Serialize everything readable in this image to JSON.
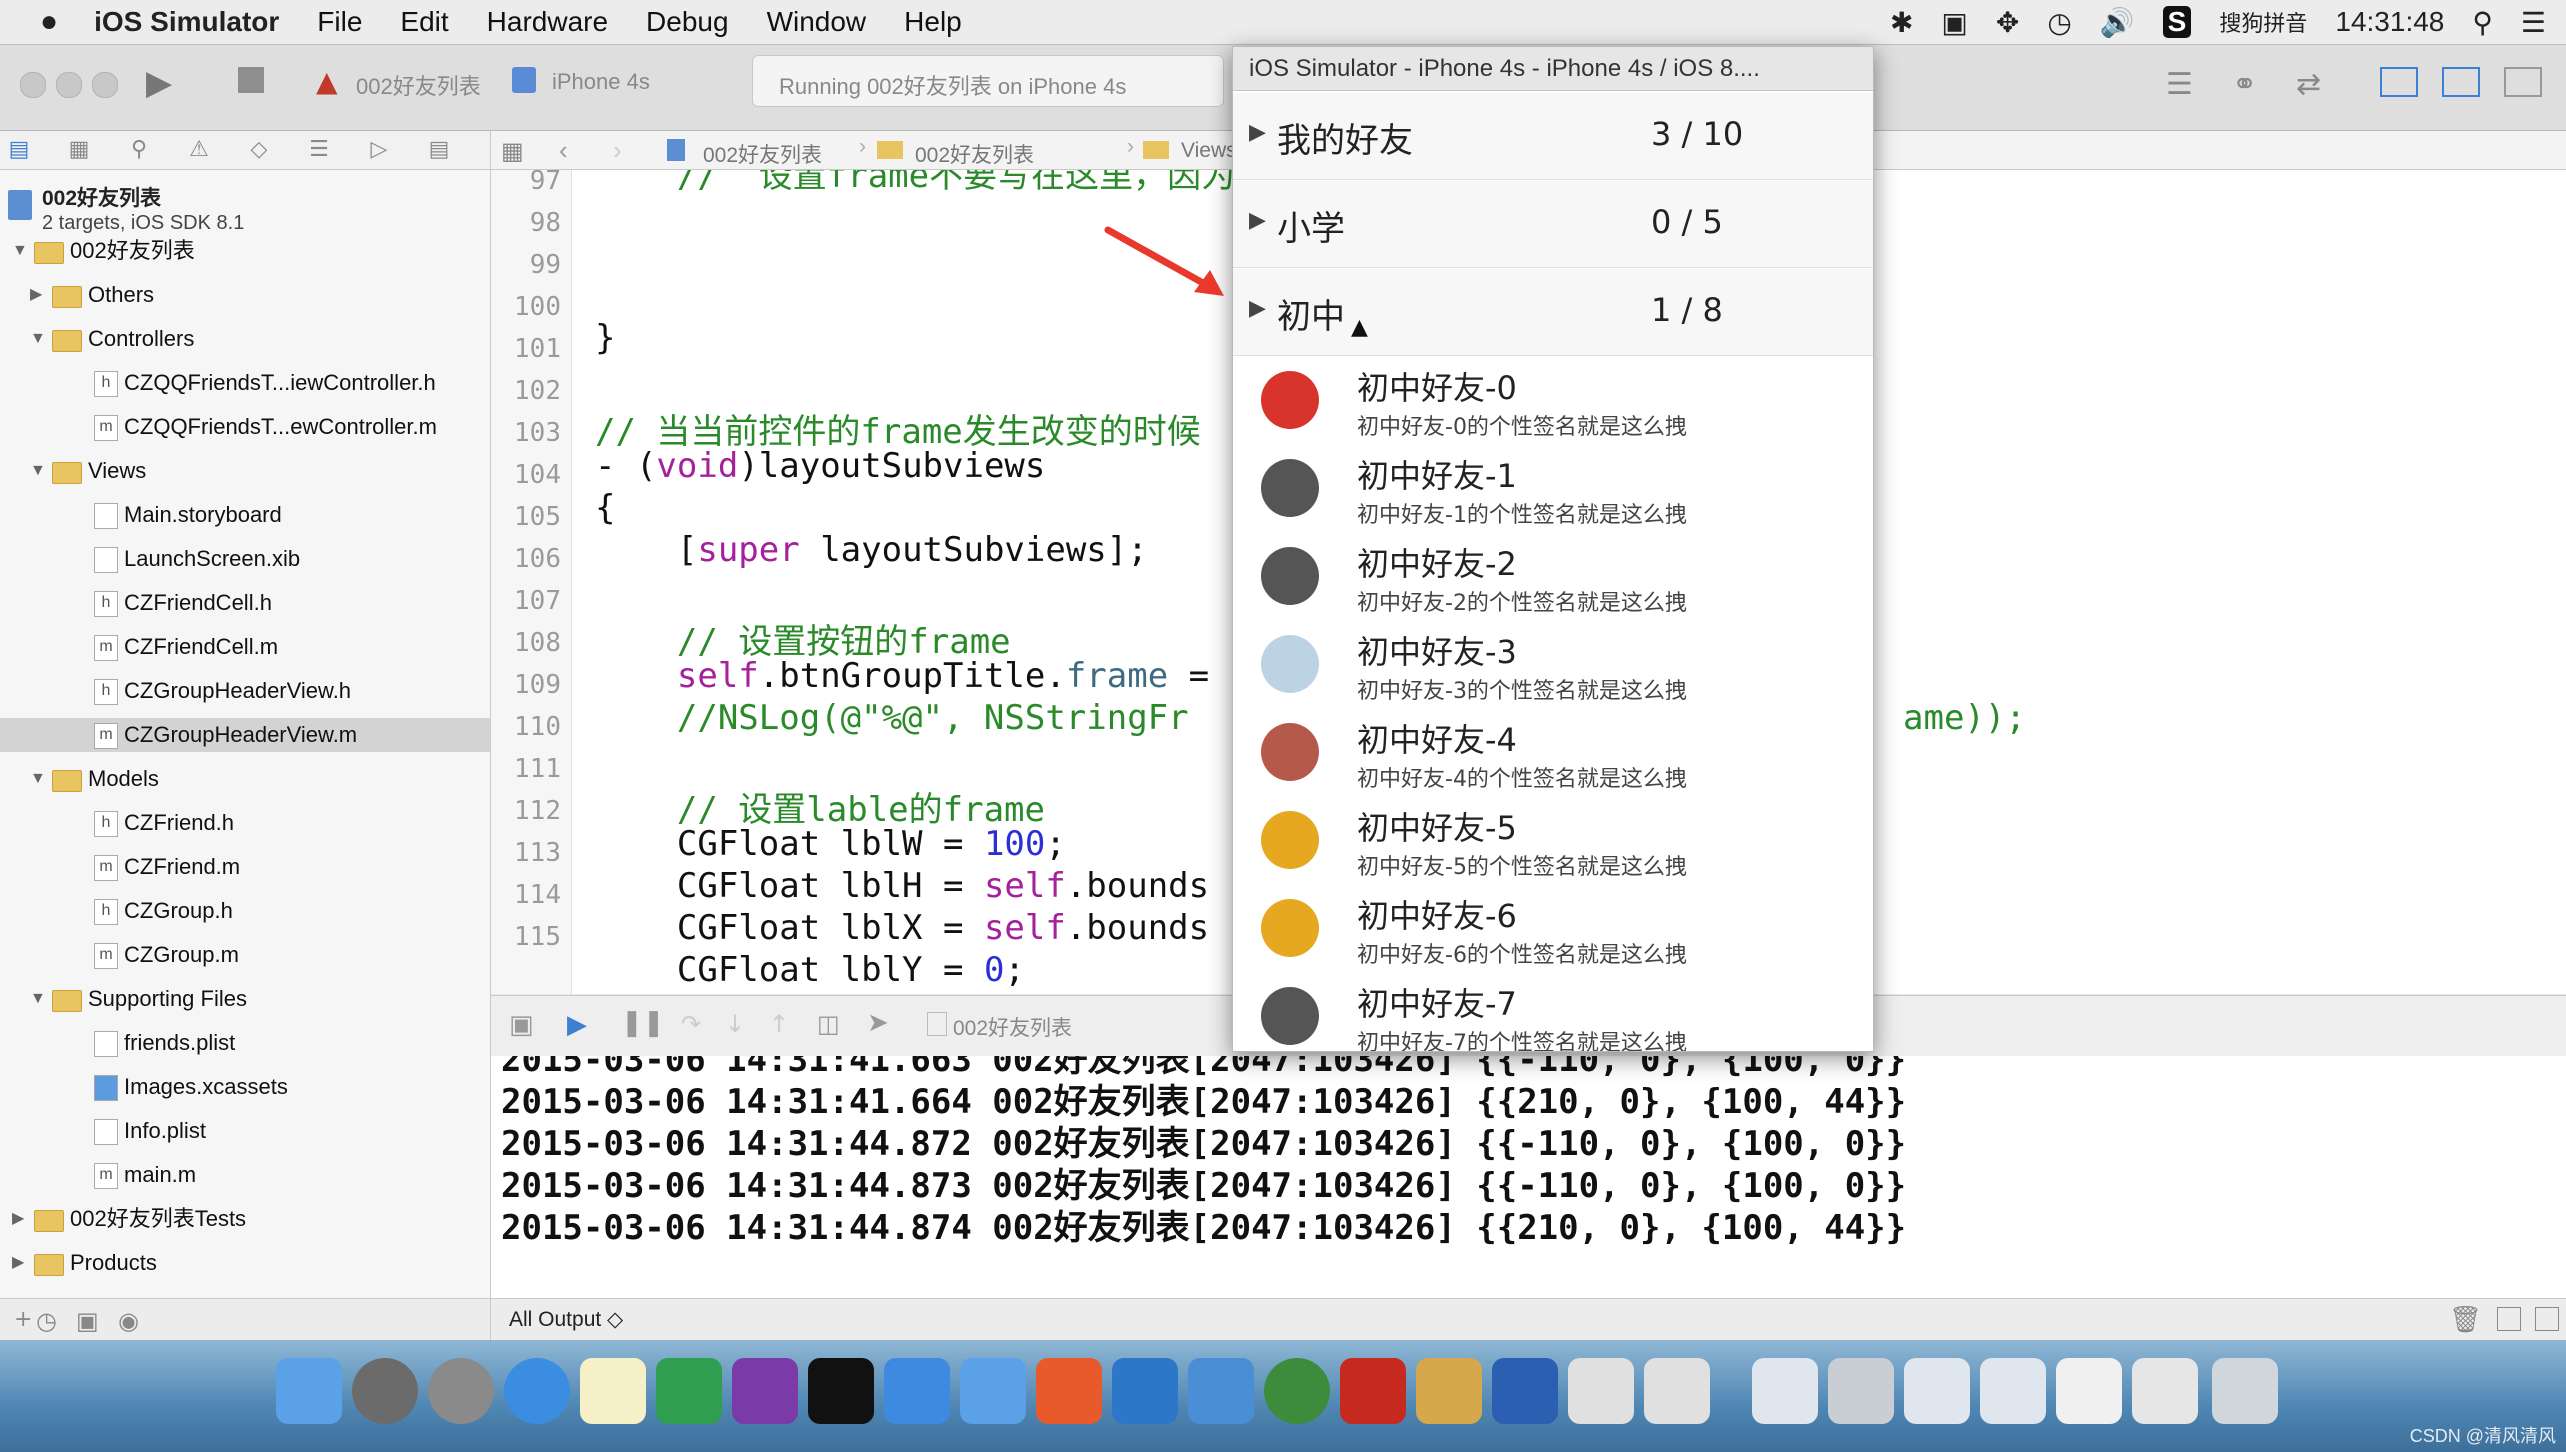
{
  "menubar": {
    "apple_icon": "apple-icon",
    "app_name": "iOS Simulator",
    "items": [
      "File",
      "Edit",
      "Hardware",
      "Debug",
      "Window",
      "Help"
    ],
    "input_method": "搜狗拼音",
    "time": "14:31:48"
  },
  "toolbar": {
    "scheme_target": "002好友列表",
    "scheme_device": "iPhone 4s",
    "status": "Running 002好友列表 on iPhone 4s"
  },
  "navigator": {
    "project_name": "002好友列表",
    "project_subtitle": "2 targets, iOS SDK 8.1",
    "items": [
      {
        "label": "002好友列表",
        "type": "folder",
        "expanded": true
      },
      {
        "label": "Others",
        "type": "folder",
        "expanded": false
      },
      {
        "label": "Controllers",
        "type": "folder",
        "expanded": true
      },
      {
        "label": "CZQQFriendsT...iewController.h",
        "type": "h"
      },
      {
        "label": "CZQQFriendsT...ewController.m",
        "type": "m"
      },
      {
        "label": "Views",
        "type": "folder",
        "expanded": true
      },
      {
        "label": "Main.storyboard",
        "type": "file"
      },
      {
        "label": "LaunchScreen.xib",
        "type": "file"
      },
      {
        "label": "CZFriendCell.h",
        "type": "h"
      },
      {
        "label": "CZFriendCell.m",
        "type": "m"
      },
      {
        "label": "CZGroupHeaderView.h",
        "type": "h"
      },
      {
        "label": "CZGroupHeaderView.m",
        "type": "m",
        "selected": true
      },
      {
        "label": "Models",
        "type": "folder",
        "expanded": true
      },
      {
        "label": "CZFriend.h",
        "type": "h"
      },
      {
        "label": "CZFriend.m",
        "type": "m"
      },
      {
        "label": "CZGroup.h",
        "type": "h"
      },
      {
        "label": "CZGroup.m",
        "type": "m"
      },
      {
        "label": "Supporting Files",
        "type": "folder",
        "expanded": true
      },
      {
        "label": "friends.plist",
        "type": "file"
      },
      {
        "label": "Images.xcassets",
        "type": "assets"
      },
      {
        "label": "Info.plist",
        "type": "file"
      },
      {
        "label": "main.m",
        "type": "m"
      },
      {
        "label": "002好友列表Tests",
        "type": "folder",
        "expanded": false
      },
      {
        "label": "Products",
        "type": "folder",
        "expanded": false
      }
    ]
  },
  "jumpbar": {
    "crumbs": [
      "002好友列表",
      "002好友列表",
      "Views",
      "m"
    ]
  },
  "editor": {
    "line_numbers": [
      "97",
      "98",
      "99",
      "100",
      "101",
      "102",
      "103",
      "104",
      "105",
      "106",
      "107",
      "108",
      "109",
      "110",
      "111",
      "112",
      "113",
      "114",
      "115"
    ],
    "lines": {
      "l100": "}",
      "l102": "// 当当前控件的frame发生改变的时候",
      "l103a": "- (",
      "l103b": "void",
      "l103c": ")layoutSubviews",
      "l104": "{",
      "l105a": "    [",
      "l105b": "super",
      "l105c": " layoutSubviews];",
      "l107": "    // 设置按钮的frame",
      "l108a": "    ",
      "l108b": "self",
      "l108c": ".btnGroupTitle.",
      "l108d": "frame",
      "l108e": " =",
      "l109a": "    //NSLog(@\"%@\", NSStringFr",
      "l109b": "ame));",
      "l111": "    // 设置lable的frame",
      "l112a": "    CGFloat lblW = ",
      "l112b": "100",
      "l112c": ";",
      "l113a": "    CGFloat lblH = ",
      "l113b": "self",
      "l113c": ".bounds",
      "l114a": "    CGFloat lblX = ",
      "l114b": "self",
      "l114c": ".bounds",
      "l115a": "    CGFloat lblY = ",
      "l115b": "0",
      "l115c": ";"
    }
  },
  "debugbar": {
    "target_label": "002好友列表"
  },
  "console": {
    "lines": [
      "2015-03-06 14:31:41.664 002好友列表[2047:103426] {{210, 0}, {100, 44}}",
      "2015-03-06 14:31:44.872 002好友列表[2047:103426] {{-110, 0}, {100, 0}}",
      "2015-03-06 14:31:44.873 002好友列表[2047:103426] {{-110, 0}, {100, 0}}",
      "2015-03-06 14:31:44.874 002好友列表[2047:103426] {{210, 0}, {100, 44}}"
    ],
    "output_filter": "All Output ◇"
  },
  "simulator": {
    "title": "iOS Simulator - iPhone 4s - iPhone 4s / iOS 8....",
    "groups": [
      {
        "name": "我的好友",
        "count": "3 / 10"
      },
      {
        "name": "小学",
        "count": "0 / 5"
      },
      {
        "name": "初中",
        "count": "1 / 8"
      }
    ],
    "friends": [
      {
        "name": "初中好友-0",
        "sig": "初中好友-0的个性签名就是这么拽",
        "avatar": "red-badge-avatar",
        "color": "#d8342b"
      },
      {
        "name": "初中好友-1",
        "sig": "初中好友-1的个性签名就是这么拽",
        "avatar": "panda-avatar",
        "color": "#555555"
      },
      {
        "name": "初中好友-2",
        "sig": "初中好友-2的个性签名就是这么拽",
        "avatar": "panda-avatar",
        "color": "#555555"
      },
      {
        "name": "初中好友-3",
        "sig": "初中好友-3的个性签名就是这么拽",
        "avatar": "cloud-avatar",
        "color": "#bcd3e3"
      },
      {
        "name": "初中好友-4",
        "sig": "初中好友-4的个性签名就是这么拽",
        "avatar": "people-avatar",
        "color": "#b55a4a"
      },
      {
        "name": "初中好友-5",
        "sig": "初中好友-5的个性签名就是这么拽",
        "avatar": "gold-badge-avatar",
        "color": "#e6a820"
      },
      {
        "name": "初中好友-6",
        "sig": "初中好友-6的个性签名就是这么拽",
        "avatar": "gold-badge-avatar",
        "color": "#e6a820"
      },
      {
        "name": "初中好友-7",
        "sig": "初中好友-7的个性签名就是这么拽",
        "avatar": "panda-avatar",
        "color": "#555555"
      }
    ]
  },
  "watermark": "CSDN @清风清风",
  "colors": {
    "annotation_arrow": "#e8392c",
    "comment": "#2a8a2a",
    "keyword": "#a5219c",
    "number": "#2c2fd6"
  }
}
